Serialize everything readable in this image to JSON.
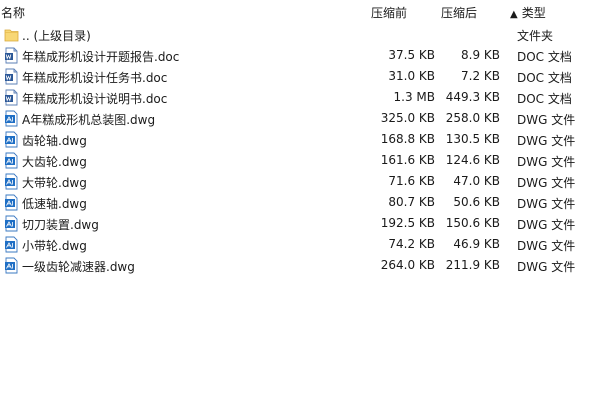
{
  "columns": {
    "name": "名称",
    "original_size": "压缩前",
    "compressed_size": "压缩后",
    "sort_arrow": "▲",
    "type": "类型"
  },
  "files": [
    {
      "name": ".. (上级目录)",
      "original": "",
      "compressed": "",
      "type": "文件夹",
      "icon": "folder-icon"
    },
    {
      "name": "年糕成形机设计开题报告.doc",
      "original": "37.5 KB",
      "compressed": "8.9 KB",
      "type": "DOC 文档",
      "icon": "doc-file-icon"
    },
    {
      "name": "年糕成形机设计任务书.doc",
      "original": "31.0 KB",
      "compressed": "7.2 KB",
      "type": "DOC 文档",
      "icon": "doc-file-icon"
    },
    {
      "name": "年糕成形机设计说明书.doc",
      "original": "1.3 MB",
      "compressed": "449.3 KB",
      "type": "DOC 文档",
      "icon": "doc-file-icon"
    },
    {
      "name": "A年糕成形机总装图.dwg",
      "original": "325.0 KB",
      "compressed": "258.0 KB",
      "type": "DWG 文件",
      "icon": "dwg-file-icon"
    },
    {
      "name": "齿轮轴.dwg",
      "original": "168.8 KB",
      "compressed": "130.5 KB",
      "type": "DWG 文件",
      "icon": "dwg-file-icon"
    },
    {
      "name": "大齿轮.dwg",
      "original": "161.6 KB",
      "compressed": "124.6 KB",
      "type": "DWG 文件",
      "icon": "dwg-file-icon"
    },
    {
      "name": "大带轮.dwg",
      "original": "71.6 KB",
      "compressed": "47.0 KB",
      "type": "DWG 文件",
      "icon": "dwg-file-icon"
    },
    {
      "name": "低速轴.dwg",
      "original": "80.7 KB",
      "compressed": "50.6 KB",
      "type": "DWG 文件",
      "icon": "dwg-file-icon"
    },
    {
      "name": "切刀装置.dwg",
      "original": "192.5 KB",
      "compressed": "150.6 KB",
      "type": "DWG 文件",
      "icon": "dwg-file-icon"
    },
    {
      "name": "小带轮.dwg",
      "original": "74.2 KB",
      "compressed": "46.9 KB",
      "type": "DWG 文件",
      "icon": "dwg-file-icon"
    },
    {
      "name": "一级齿轮减速器.dwg",
      "original": "264.0 KB",
      "compressed": "211.9 KB",
      "type": "DWG 文件",
      "icon": "dwg-file-icon"
    }
  ]
}
